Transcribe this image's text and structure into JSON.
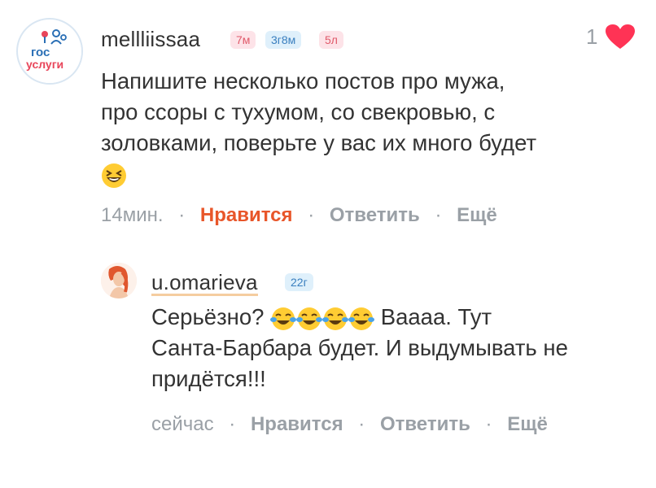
{
  "comment1": {
    "username": "mellliissaa",
    "badges": [
      "7м",
      "3г8м",
      "5л"
    ],
    "text_lines": [
      "Напишите несколько постов про мужа,",
      "про ссоры с тухумом, со свекровью, с",
      "золовками, поверьте у вас их много будет"
    ],
    "emoji": "squinting-laugh-emoji",
    "time": "14мин.",
    "like_label": "Нравится",
    "reply_label": "Ответить",
    "more_label": "Ещё",
    "like_count": "1",
    "avatar_text_1": "гос",
    "avatar_text_2": "услуги",
    "liked_color": "#e8562a"
  },
  "comment2": {
    "username": "u.omarieva",
    "badges": [
      "22г"
    ],
    "text_line1_prefix": "Серьёзно?",
    "text_line1_suffix": "Ваааа. Тут",
    "text_lines_rest": [
      "Санта-Барбара будет. И выдумывать не",
      "придётся!!!"
    ],
    "emoji": "tears-of-joy-emoji",
    "time": "сейчас",
    "like_label": "Нравится",
    "reply_label": "Ответить",
    "more_label": "Ещё"
  },
  "colors": {
    "heart": "#ff3355",
    "badge_pink_bg": "#fde3e8",
    "badge_blue_bg": "#dff0fb",
    "meta_grey": "#9aa0a6"
  }
}
